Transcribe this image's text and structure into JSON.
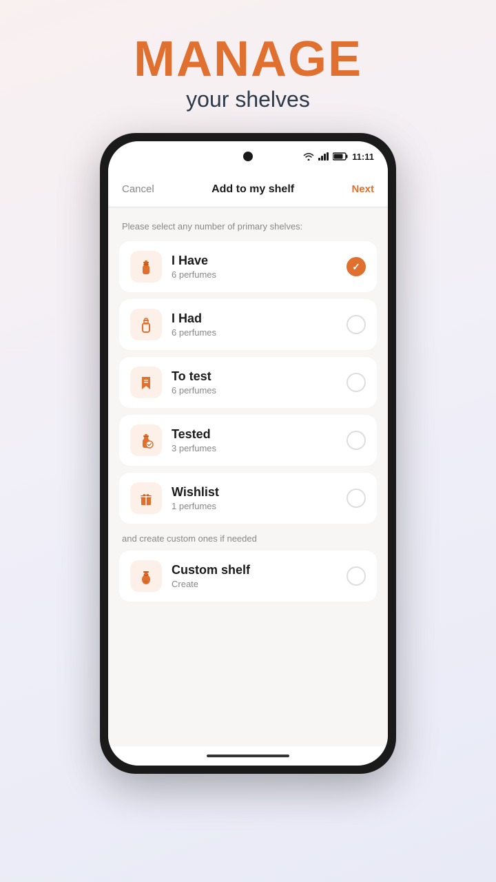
{
  "header": {
    "manage": "MANAGE",
    "subtitle": "your shelves"
  },
  "statusBar": {
    "time": "11:11"
  },
  "nav": {
    "cancel": "Cancel",
    "title": "Add to my shelf",
    "next": "Next"
  },
  "instructions": {
    "primary": "Please select any number of primary shelves:",
    "custom": "and create custom ones if needed"
  },
  "shelves": [
    {
      "id": "i-have",
      "name": "I Have",
      "count": "6 perfumes",
      "checked": true,
      "icon": "perfume-bottle"
    },
    {
      "id": "i-had",
      "name": "I Had",
      "count": "6 perfumes",
      "checked": false,
      "icon": "perfume-bottle-outline"
    },
    {
      "id": "to-test",
      "name": "To test",
      "count": "6 perfumes",
      "checked": false,
      "icon": "bookmark"
    },
    {
      "id": "tested",
      "name": "Tested",
      "count": "3 perfumes",
      "checked": false,
      "icon": "perfume-check"
    },
    {
      "id": "wishlist",
      "name": "Wishlist",
      "count": "1 perfumes",
      "checked": false,
      "icon": "gift"
    }
  ],
  "customShelf": {
    "name": "Custom shelf",
    "action": "Create"
  }
}
